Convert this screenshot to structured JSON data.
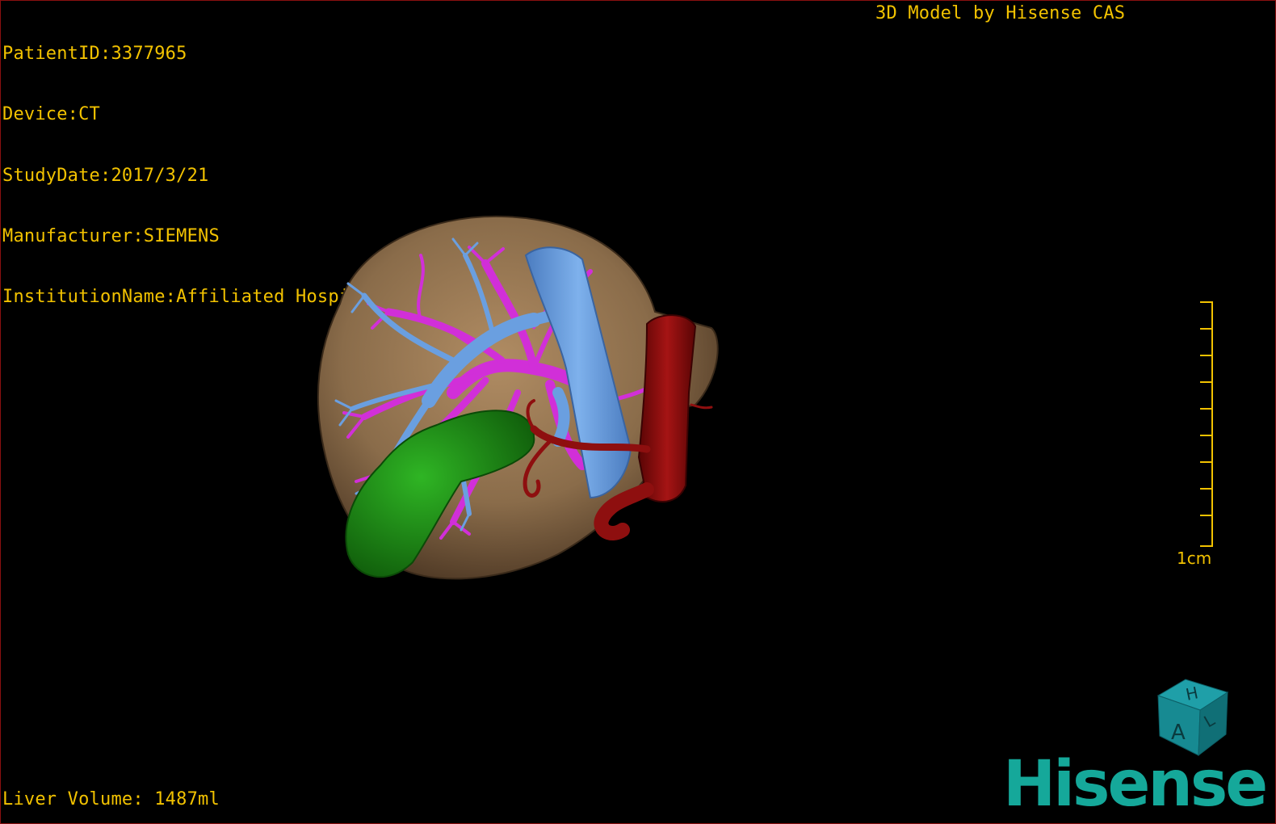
{
  "overlay": {
    "patient_id": "PatientID:3377965",
    "device": "Device:CT",
    "study_date": "StudyDate:2017/3/21",
    "manufacturer": "Manufacturer:SIEMENS",
    "institution": "InstitutionName:Affiliated Hospital Qingdao University-C",
    "credit": "3D Model by Hisense CAS",
    "liver_volume": "Liver Volume: 1487ml"
  },
  "scale_bar": {
    "label": "1cm"
  },
  "orientation_cube": {
    "face_top": "H",
    "face_front": "A",
    "face_side": "L"
  },
  "brand": {
    "logo_text": "Hisense"
  },
  "colors": {
    "overlay_text": "#f2c200",
    "liver": "#8a6c4a",
    "portal_vein": "#6a9fe0",
    "hepatic_vessels": "#d12fd8",
    "artery": "#8e0f0f",
    "gallbladder": "#1d8f14",
    "brand": "#15a89a"
  }
}
